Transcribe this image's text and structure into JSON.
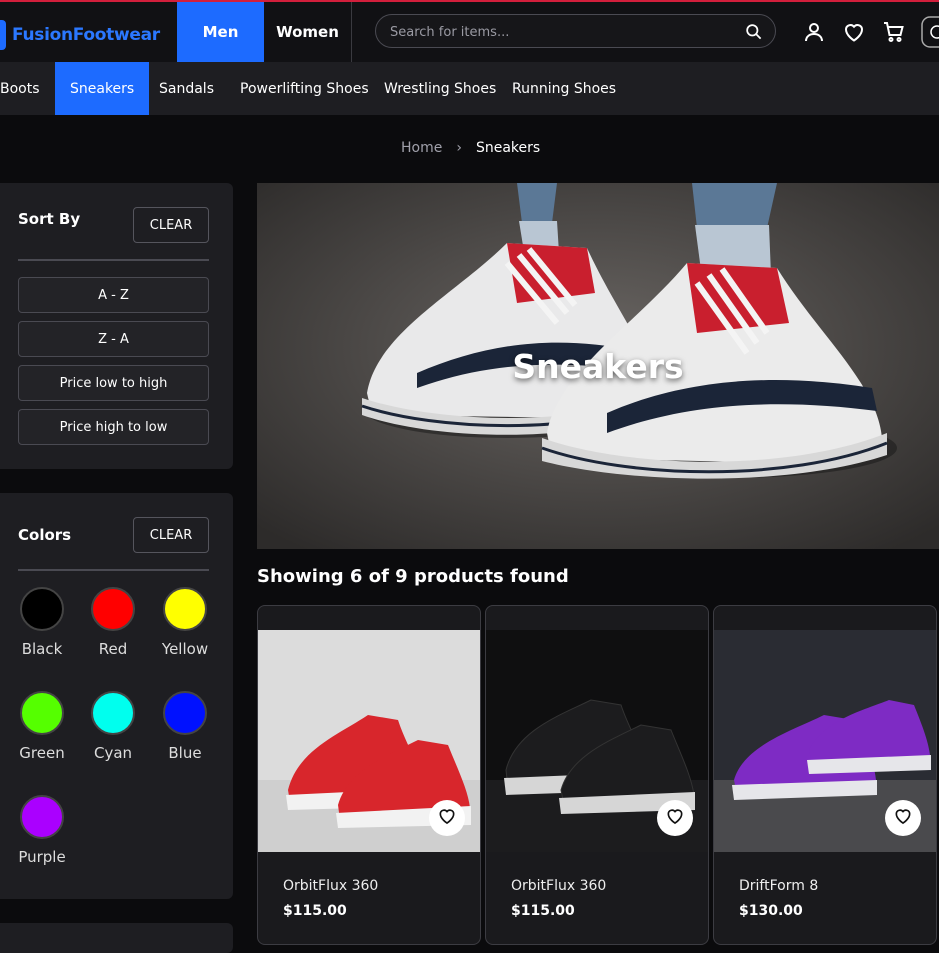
{
  "brand": {
    "name": "FusionFootwear",
    "accent": "#1d6bff"
  },
  "gender_tabs": [
    {
      "label": "Men",
      "active": true
    },
    {
      "label": "Women",
      "active": false
    }
  ],
  "search": {
    "placeholder": "Search for items...",
    "value": ""
  },
  "header_icons": [
    "search-icon",
    "user-icon",
    "heart-icon",
    "cart-icon",
    "currency-icon"
  ],
  "categories": [
    {
      "label": "Boots",
      "active": false
    },
    {
      "label": "Sneakers",
      "active": true
    },
    {
      "label": "Sandals",
      "active": false
    },
    {
      "label": "Powerlifting Shoes",
      "active": false
    },
    {
      "label": "Wrestling Shoes",
      "active": false
    },
    {
      "label": "Running Shoes",
      "active": false
    }
  ],
  "breadcrumb": {
    "home": "Home",
    "current": "Sneakers"
  },
  "sort": {
    "title": "Sort By",
    "clear": "CLEAR",
    "options": [
      "A - Z",
      "Z - A",
      "Price low to high",
      "Price high to low"
    ]
  },
  "colors": {
    "title": "Colors",
    "clear": "CLEAR",
    "items": [
      {
        "label": "Black",
        "hex": "#000000"
      },
      {
        "label": "Red",
        "hex": "#ff0000"
      },
      {
        "label": "Yellow",
        "hex": "#ffff00"
      },
      {
        "label": "Green",
        "hex": "#55ff00"
      },
      {
        "label": "Cyan",
        "hex": "#00ffee"
      },
      {
        "label": "Blue",
        "hex": "#0011ff"
      },
      {
        "label": "Purple",
        "hex": "#aa00ff"
      }
    ]
  },
  "hero": {
    "title": "Sneakers"
  },
  "results": {
    "text": "Showing 6 of 9 products found"
  },
  "products": [
    {
      "name": "OrbitFlux 360",
      "price": "$115.00",
      "shoe_color": "#d8262c"
    },
    {
      "name": "OrbitFlux 360",
      "price": "$115.00",
      "shoe_color": "#1c1c1e"
    },
    {
      "name": "DriftForm 8",
      "price": "$130.00",
      "shoe_color": "#7e2bc4"
    }
  ]
}
